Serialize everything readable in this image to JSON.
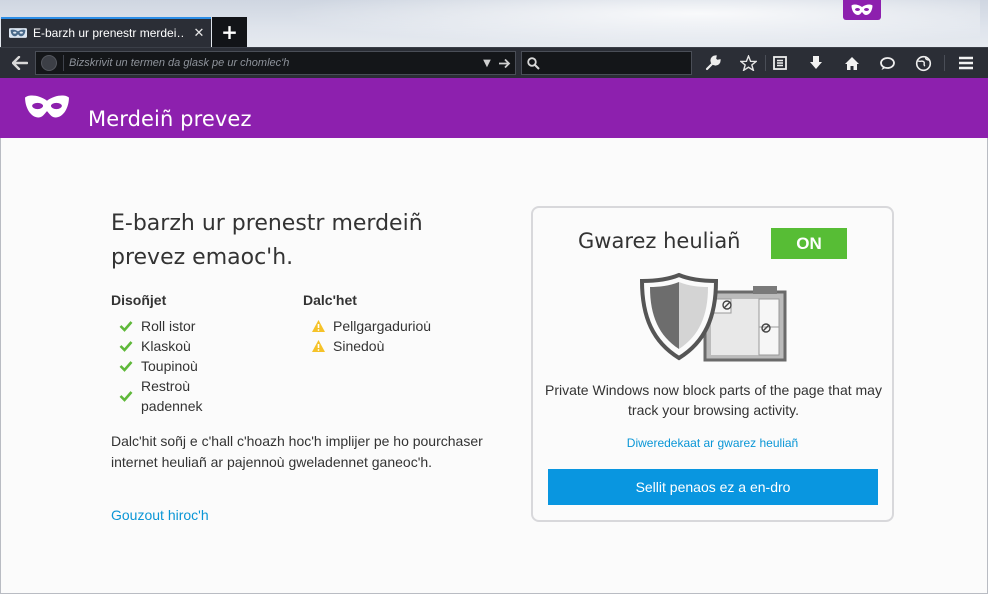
{
  "browser": {
    "tab": {
      "title": "E-barzh ur prenestr merdei…",
      "close_glyph": "✕"
    },
    "new_tab_glyph": "+",
    "urlbar": {
      "placeholder": "Bizskrivit un termen da glask pe ur chomlec'h",
      "value": ""
    },
    "searchbar": {
      "placeholder": "",
      "value": ""
    },
    "toolbar_icons": [
      "wrench-icon",
      "bookmark-star-icon",
      "reading-list-icon",
      "downloads-icon",
      "home-icon",
      "chat-icon",
      "globe-icon",
      "menu-icon"
    ]
  },
  "header": {
    "title": "Merdeiñ prevez"
  },
  "main": {
    "heading": "E-barzh ur prenestr merdeiñ prevez emaoc'h.",
    "not_saved": {
      "heading": "Disoñjet",
      "items": [
        "Roll istor",
        "Klaskoù",
        "Toupinoù",
        "Restroù padennek"
      ]
    },
    "saved": {
      "heading": "Dalc'het",
      "items": [
        "Pellgargaduriou̇",
        "Sinedoù"
      ]
    },
    "notice": "Dalc'hit soñj e c'hall c'hoazh hoc'h implijer pe ho pourchaser internet heuliañ ar pajennoù gweladennet ganeoc'h.",
    "learn_more": "Gouzout hiroc'h"
  },
  "tracking_protection": {
    "title": "Gwarez heuliañ",
    "status": "ON",
    "description": "Private Windows now block parts of the page that may track your browsing activity.",
    "disable_link": "Diweredekaat ar gwarez heuliañ",
    "tour_button": "Sellit penaos ez a en-dro"
  },
  "colors": {
    "private_purple": "#8d20ae",
    "toolbar_dark": "#2b2e36",
    "toggle_green": "#57bd35",
    "button_blue": "#0996e0",
    "link_blue": "#0a96d6",
    "check_green": "#5fb83a",
    "warning_yellow": "#f5c228"
  }
}
